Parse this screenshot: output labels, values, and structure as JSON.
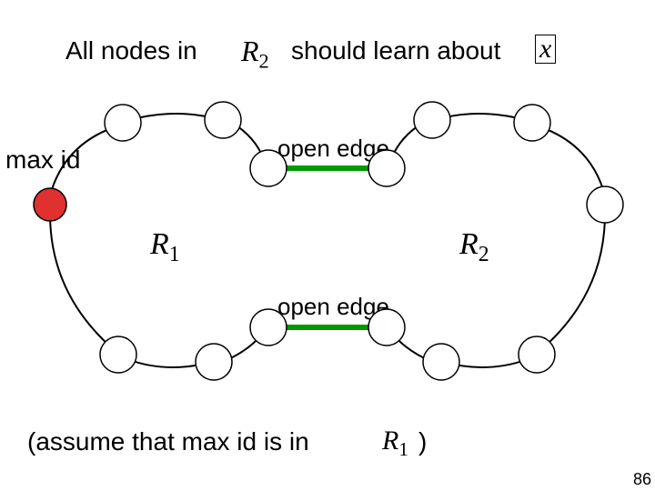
{
  "title": {
    "part1": "All nodes in",
    "part2": "should learn about"
  },
  "symbols": {
    "R1": "R",
    "R1_sub": "1",
    "R2": "R",
    "R2_sub": "2",
    "x": "x"
  },
  "labels": {
    "max_id": "max id",
    "open_edge_top": "open edge",
    "open_edge_bottom": "open edge"
  },
  "footer": {
    "part1": "(assume that max id is in",
    "part2": ")"
  },
  "page": "86",
  "chart_data": {
    "type": "diagram",
    "description": "Two rings R1 (left) and R2 (right) joined by two green open edges (top and bottom). Highlighted red node x on left ring is the max id.",
    "nodes_left_ring": 7,
    "nodes_right_ring": 7,
    "open_edges": 2,
    "highlight_node": "x",
    "regions": [
      "R1",
      "R2"
    ]
  }
}
